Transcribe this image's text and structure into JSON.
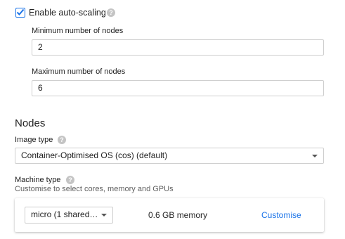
{
  "autoscaling": {
    "checkbox_label": "Enable auto-scaling",
    "checked": true,
    "help_icon": "help-circle-icon"
  },
  "min_nodes": {
    "label": "Minimum number of nodes",
    "value": "2"
  },
  "max_nodes": {
    "label": "Maximum number of nodes",
    "value": "6"
  },
  "nodes_section": {
    "title": "Nodes"
  },
  "image_type": {
    "label": "Image type",
    "help_icon": "help-circle-icon",
    "selected": "Container-Optimised OS (cos) (default)"
  },
  "machine_type": {
    "label": "Machine type",
    "help_icon": "help-circle-icon",
    "description": "Customise to select cores, memory and GPUs",
    "selected": "micro (1 shared…",
    "memory": "0.6 GB memory",
    "customise_label": "Customise"
  },
  "colors": {
    "accent": "#1a73e8",
    "border": "#cfcfcf",
    "help_icon_bg": "#c4c4c4"
  }
}
